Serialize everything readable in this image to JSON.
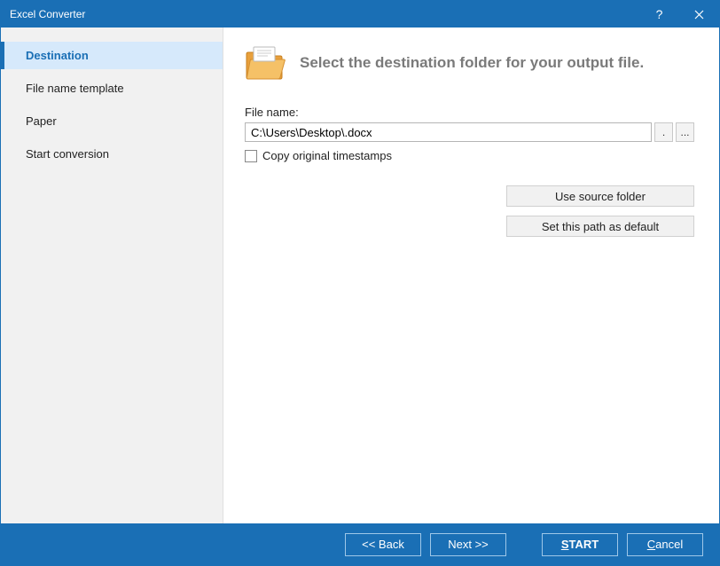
{
  "window": {
    "title": "Excel Converter"
  },
  "sidebar": {
    "items": [
      {
        "label": "Destination",
        "active": true
      },
      {
        "label": "File name template",
        "active": false
      },
      {
        "label": "Paper",
        "active": false
      },
      {
        "label": "Start conversion",
        "active": false
      }
    ]
  },
  "main": {
    "header": "Select the destination folder for your output file.",
    "file_name_label": "File name:",
    "file_name_value": "C:\\Users\\Desktop\\.docx",
    "insert_macros_label": ".",
    "browse_label": "...",
    "copy_timestamps_label": "Copy original timestamps",
    "copy_timestamps_checked": false,
    "use_source_folder": "Use source folder",
    "set_default_path": "Set this path as default"
  },
  "footer": {
    "back": "<< Back",
    "next": "Next >>",
    "start_prefix": "S",
    "start_rest": "TART",
    "cancel_prefix": "C",
    "cancel_rest": "ancel"
  }
}
